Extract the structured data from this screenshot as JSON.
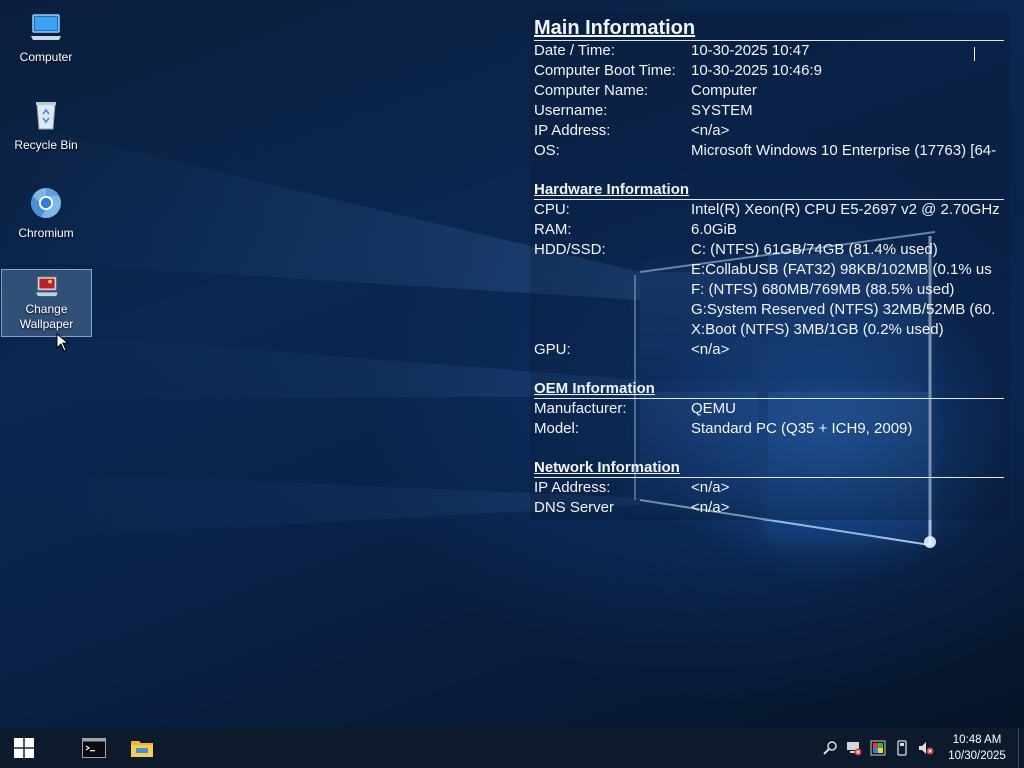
{
  "desktop": {
    "icons": [
      {
        "label": "Computer",
        "icon": "computer-icon"
      },
      {
        "label": "Recycle Bin",
        "icon": "recycle-bin-icon"
      },
      {
        "label": "Chromium",
        "icon": "chromium-icon"
      },
      {
        "label": "Change Wallpaper",
        "icon": "wallpaper-icon",
        "selected": true
      }
    ]
  },
  "info": {
    "main": {
      "title": "Main Information",
      "rows": [
        {
          "key": "Date / Time:",
          "value": "10-30-2025 10:47"
        },
        {
          "key": "Computer Boot Time:",
          "value": "10-30-2025 10:46:9"
        },
        {
          "key": "Computer Name:",
          "value": "Computer"
        },
        {
          "key": "Username:",
          "value": "SYSTEM"
        },
        {
          "key": "IP Address:",
          "value": "<n/a>"
        },
        {
          "key": "OS:",
          "value": "Microsoft Windows 10 Enterprise (17763) [64-"
        }
      ]
    },
    "hardware": {
      "title": "Hardware Information",
      "rows": [
        {
          "key": "CPU:",
          "value": "Intel(R) Xeon(R) CPU E5-2697 v2 @ 2.70GHz"
        },
        {
          "key": "RAM:",
          "value": "6.0GiB"
        },
        {
          "key": "HDD/SSD:",
          "value": "C: (NTFS) 61GB/74GB (81.4% used)"
        },
        {
          "key": "",
          "value": "E:CollabUSB (FAT32) 98KB/102MB (0.1% us"
        },
        {
          "key": "",
          "value": "F: (NTFS) 680MB/769MB (88.5% used)"
        },
        {
          "key": "",
          "value": "G:System Reserved (NTFS) 32MB/52MB (60."
        },
        {
          "key": "",
          "value": "X:Boot (NTFS) 3MB/1GB (0.2% used)"
        },
        {
          "key": "GPU:",
          "value": "<n/a>"
        }
      ]
    },
    "oem": {
      "title": "OEM Information",
      "rows": [
        {
          "key": "Manufacturer:",
          "value": "QEMU"
        },
        {
          "key": "Model:",
          "value": "Standard PC (Q35 + ICH9, 2009)"
        }
      ]
    },
    "network": {
      "title": "Network Information",
      "rows": [
        {
          "key": "IP Address:",
          "value": "<n/a>"
        },
        {
          "key": "DNS Server",
          "value": "<n/a>"
        }
      ]
    }
  },
  "taskbar": {
    "start_icon": "windows-start-icon",
    "pinned": [
      {
        "icon": "command-prompt-icon"
      },
      {
        "icon": "file-explorer-icon"
      }
    ],
    "tray_icons": [
      "search-tray-icon",
      "network-disconnected-icon",
      "color-palette-icon",
      "usb-device-icon",
      "volume-muted-icon"
    ],
    "clock": {
      "time": "10:48 AM",
      "date": "10/30/2025"
    }
  },
  "colors": {
    "taskbar": "#0d1a2b",
    "wallpaper_dark": "#0a1f3c",
    "wallpaper_glow": "#4aa3ff",
    "selection": "#7fa8cf"
  }
}
